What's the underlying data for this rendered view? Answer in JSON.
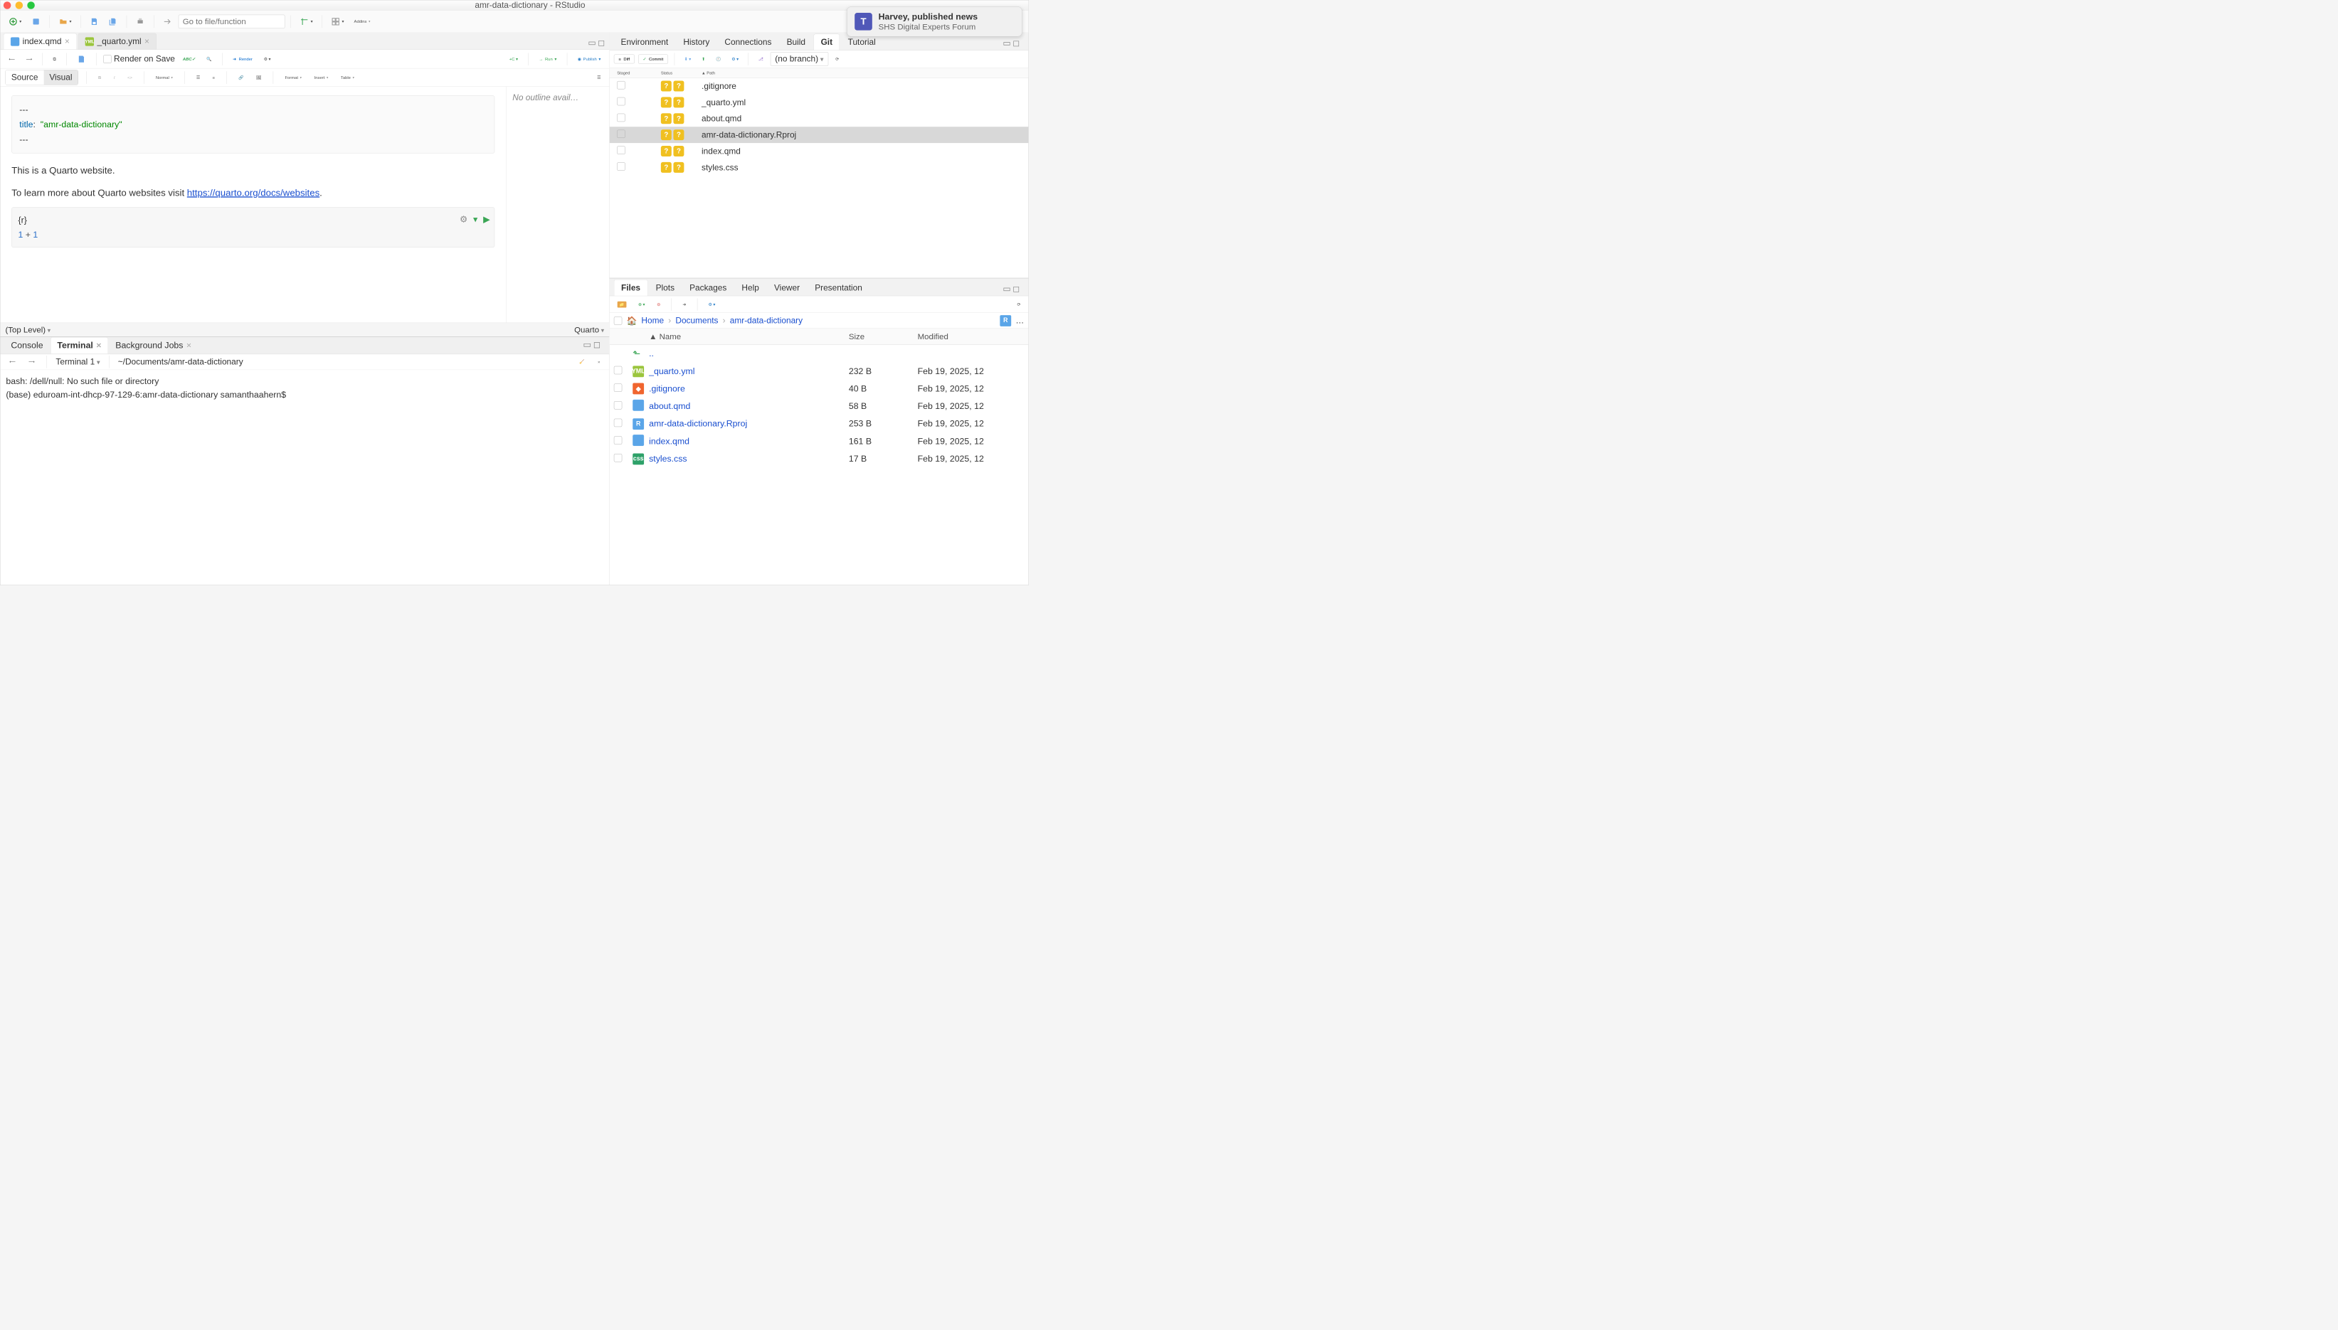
{
  "window_title": "amr-data-dictionary - RStudio",
  "toolbar": {
    "goto_placeholder": "Go to file/function",
    "addins": "Addins"
  },
  "notification": {
    "title": "Harvey, published news",
    "sub": "SHS Digital Experts Forum"
  },
  "editor": {
    "tabs": [
      {
        "label": "index.qmd",
        "type": "qmd"
      },
      {
        "label": "_quarto.yml",
        "type": "yml"
      }
    ],
    "render_on_save": "Render on Save",
    "render": "Render",
    "run": "Run",
    "publish": "Publish",
    "source": "Source",
    "visual": "Visual",
    "normal": "Normal",
    "format": "Format",
    "insert": "Insert",
    "table": "Table",
    "yaml_key": "title",
    "yaml_val": "\"amr-data-dictionary\"",
    "p1": "This is a Quarto website.",
    "p2": "To learn more about Quarto websites visit ",
    "link": "https://quarto.org/docs/websites",
    "dot": ".",
    "chunk_lang": "{r}",
    "chunk_code1": "1",
    "chunk_op": "+",
    "chunk_code2": "1",
    "outline": "No outline avail…",
    "scope": "(Top Level)",
    "doc_type": "Quarto"
  },
  "console": {
    "tabs": [
      "Console",
      "Terminal",
      "Background Jobs"
    ],
    "active": 1,
    "term_name": "Terminal 1",
    "term_path": "~/Documents/amr-data-dictionary",
    "line1": "bash: /dell/null: No such file or directory",
    "line2": "(base) eduroam-int-dhcp-97-129-6:amr-data-dictionary samanthaahern$"
  },
  "env": {
    "tabs": [
      "Environment",
      "History",
      "Connections",
      "Build",
      "Git",
      "Tutorial"
    ],
    "active": 4,
    "diff": "Diff",
    "commit": "Commit",
    "branch": "(no branch)",
    "head": [
      "Staged",
      "Status",
      "Path"
    ],
    "rows": [
      {
        "path": ".gitignore"
      },
      {
        "path": "_quarto.yml"
      },
      {
        "path": "about.qmd"
      },
      {
        "path": "amr-data-dictionary.Rproj",
        "selected": true
      },
      {
        "path": "index.qmd"
      },
      {
        "path": "styles.css"
      }
    ]
  },
  "files": {
    "tabs": [
      "Files",
      "Plots",
      "Packages",
      "Help",
      "Viewer",
      "Presentation"
    ],
    "active": 0,
    "crumbs": [
      "Home",
      "Documents",
      "amr-data-dictionary"
    ],
    "head": [
      "Name",
      "Size",
      "Modified"
    ],
    "up": "..",
    "rows": [
      {
        "name": "_quarto.yml",
        "size": "232 B",
        "mod": "Feb 19, 2025, 12",
        "ico": "yml"
      },
      {
        "name": ".gitignore",
        "size": "40 B",
        "mod": "Feb 19, 2025, 12",
        "ico": "git"
      },
      {
        "name": "about.qmd",
        "size": "58 B",
        "mod": "Feb 19, 2025, 12",
        "ico": "qmd"
      },
      {
        "name": "amr-data-dictionary.Rproj",
        "size": "253 B",
        "mod": "Feb 19, 2025, 12",
        "ico": "rproj"
      },
      {
        "name": "index.qmd",
        "size": "161 B",
        "mod": "Feb 19, 2025, 12",
        "ico": "qmd"
      },
      {
        "name": "styles.css",
        "size": "17 B",
        "mod": "Feb 19, 2025, 12",
        "ico": "css"
      }
    ]
  }
}
